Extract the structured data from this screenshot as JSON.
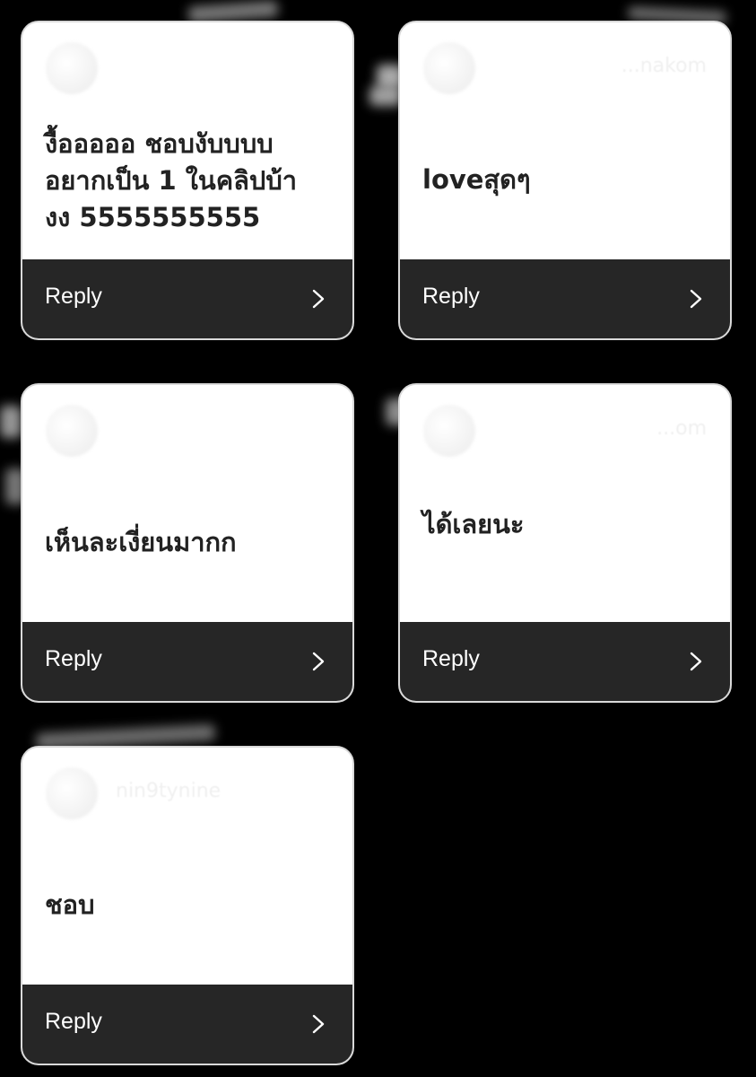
{
  "cards": [
    {
      "username": "",
      "comment": "งื้อออออ ชอบงับบบบ\nอยากเป็น 1 ในคลิปบ้า\nงง 5555555555",
      "reply_label": "Reply"
    },
    {
      "username": "...nakom",
      "comment": "loveสุดๆ",
      "reply_label": "Reply"
    },
    {
      "username": "",
      "comment": "เห็นละเงี่ยนมากก",
      "reply_label": "Reply"
    },
    {
      "username": "...om",
      "comment": "ได้เลยนะ",
      "reply_label": "Reply"
    },
    {
      "username": "nin9tynine",
      "comment": "ชอบ",
      "reply_label": "Reply"
    }
  ],
  "colors": {
    "background": "#000000",
    "card": "#ffffff",
    "reply_bar": "#262626",
    "comment_text": "#222222"
  },
  "icons": {
    "reply_arrow": "chevron-right-icon"
  }
}
